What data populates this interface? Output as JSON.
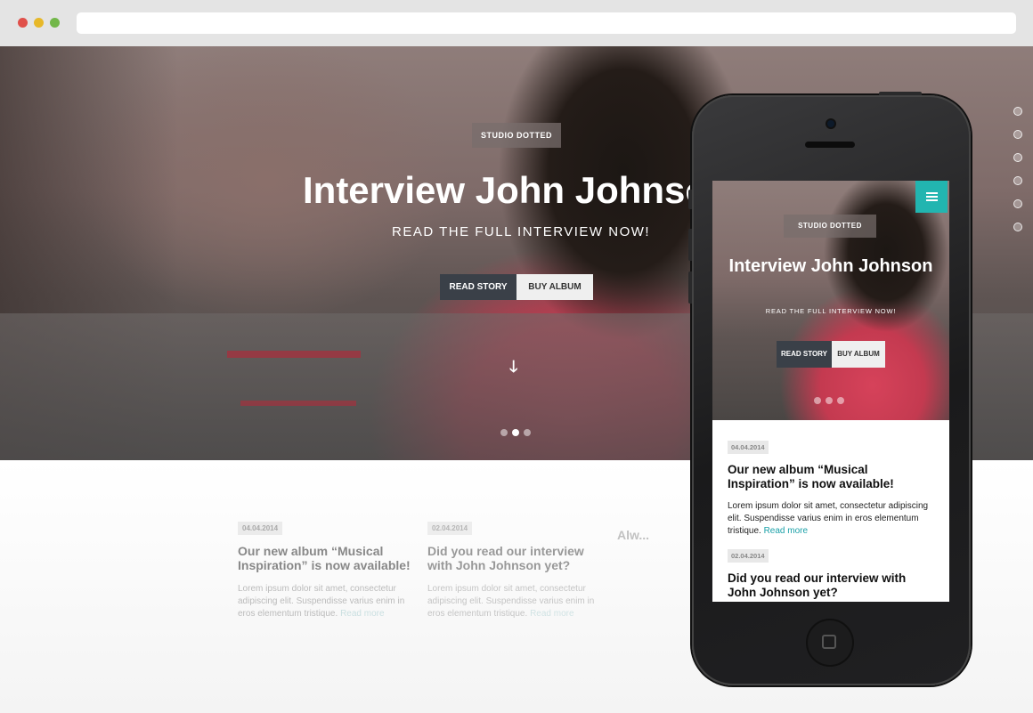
{
  "browser": {
    "url": ""
  },
  "hero": {
    "tag": "STUDIO DOTTED",
    "title": "Interview John Johnson",
    "subtitle": "READ THE FULL INTERVIEW NOW!",
    "read_story_label": "READ STORY",
    "buy_album_label": "BUY ALBUM",
    "down_arrow": "🡓",
    "slider": {
      "count": 3,
      "active_index": 1
    },
    "side_nav_count": 6
  },
  "posts": [
    {
      "date": "04.04.2014",
      "title": "Our new album “Musical Inspiration” is now available!",
      "excerpt": "Lorem ipsum dolor sit amet, consectetur adipiscing elit. Suspendisse varius enim in eros elementum tristique.",
      "read_more": "Read more"
    },
    {
      "date": "02.04.2014",
      "title": "Did you read our interview with John Johnson yet?",
      "excerpt": "Lorem ipsum dolor sit amet, consectetur adipiscing elit. Suspendisse varius enim in eros elementum tristique.",
      "read_more": "Read more"
    },
    {
      "date": "",
      "title": "Alw...",
      "excerpt": "",
      "read_more": ""
    }
  ],
  "mobile": {
    "tag": "STUDIO DOTTED",
    "title": "Interview John Johnson",
    "subtitle": "READ THE FULL INTERVIEW NOW!",
    "read_story_label": "READ STORY",
    "buy_album_label": "BUY ALBUM",
    "post1": {
      "date": "04.04.2014",
      "title": "Our new album “Musical Inspiration” is now available!",
      "excerpt": "Lorem ipsum dolor sit amet, consectetur adipiscing elit. Suspendisse varius enim in eros elementum tristique.",
      "read_more": "Read more"
    },
    "post2": {
      "date": "02.04.2014",
      "title": "Did you read our interview with John Johnson yet?"
    }
  },
  "colors": {
    "accent": "#22b5b0",
    "button_dark": "#3a4048",
    "button_light": "#efefef"
  },
  "icons": [
    "menu-icon",
    "arrow-down-icon",
    "home-button-icon"
  ]
}
